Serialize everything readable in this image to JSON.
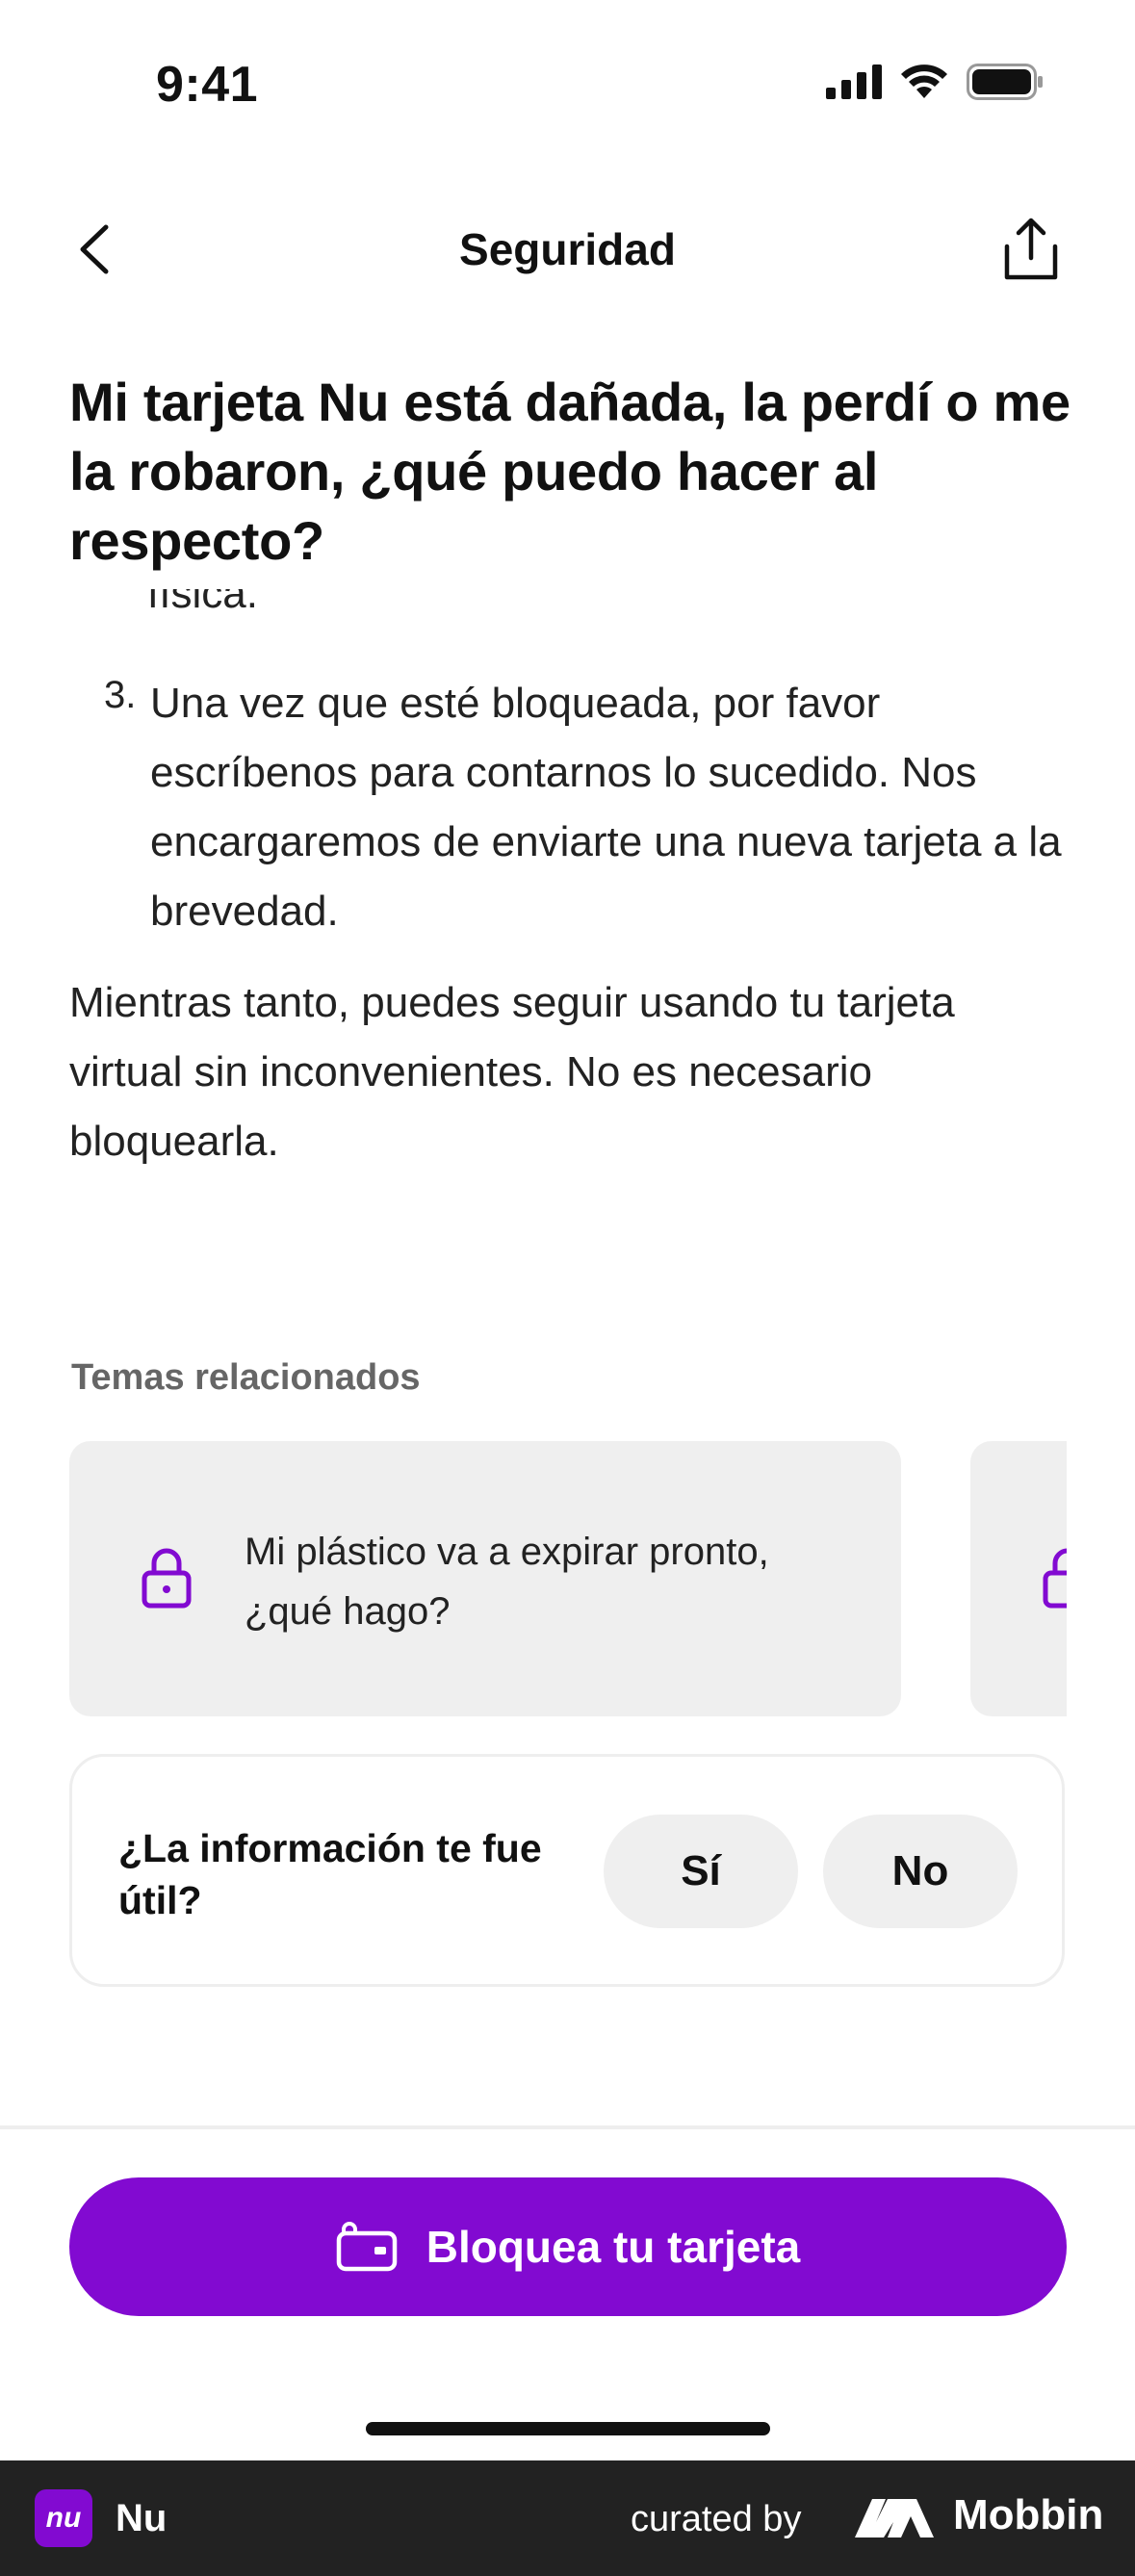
{
  "status_bar": {
    "time": "9:41"
  },
  "nav": {
    "title": "Seguridad"
  },
  "article": {
    "headline": "Mi tarjeta Nu está dañada, la perdí o me la robaron, ¿qué puedo hacer al respecto?",
    "clipped_line": "física.",
    "step_number": "3.",
    "step_text": "Una vez que esté bloqueada, por favor escríbenos para contarnos lo sucedido. Nos encargaremos de enviarte una nueva tarjeta a la brevedad.",
    "paragraph": "Mientras tanto, puedes seguir usando tu tarjeta virtual sin inconvenientes. No es necesario bloquearla."
  },
  "related": {
    "heading": "Temas relacionados",
    "cards": [
      {
        "label": "Mi plástico va a expirar pronto, ¿qué hago?",
        "icon": "lock-icon"
      }
    ]
  },
  "feedback": {
    "question": "¿La información te fue útil?",
    "yes_label": "Sí",
    "no_label": "No"
  },
  "cta": {
    "label": "Bloquea tu tarjeta",
    "icon": "card-lock-icon"
  },
  "footer": {
    "app_name": "Nu",
    "logo_text": "nu",
    "curated_by": "curated by",
    "brand": "Mobbin"
  },
  "colors": {
    "accent": "#820ad1",
    "card_bg": "#efefef",
    "footer_bg": "#222222"
  }
}
